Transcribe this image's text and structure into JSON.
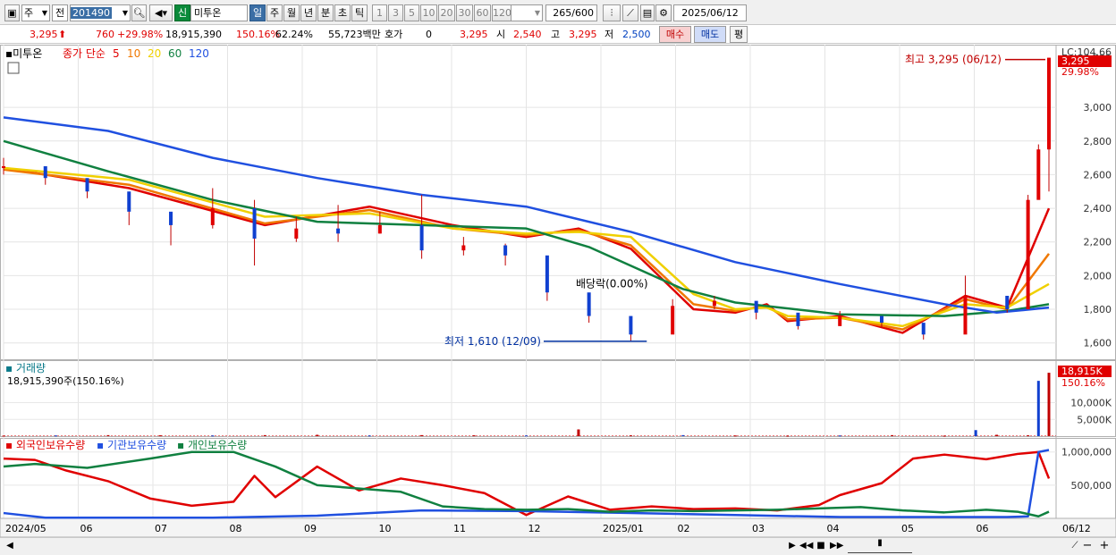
{
  "toolbar": {
    "period_type": "주",
    "market": "전",
    "code": "201490",
    "new_badge": "신",
    "stock_name": "미투온",
    "periods": [
      "일",
      "주",
      "월",
      "년",
      "분",
      "초",
      "틱"
    ],
    "active_period": "일",
    "intervals": [
      "1",
      "3",
      "5",
      "10",
      "20",
      "30",
      "60",
      "120"
    ],
    "count": "265",
    "count_total": "/600",
    "date": "2025/06/12"
  },
  "quote": {
    "price": "3,295",
    "change": "760",
    "change_pct": "+29.98%",
    "volume": "18,915,390",
    "volume_ratio": "150.16%",
    "turnover": "62.24%",
    "amount": "55,723백만",
    "hoga_label": "호가",
    "hoga_value": "0",
    "ask_price": "3,295",
    "open_label": "시",
    "open": "2,540",
    "high_label": "고",
    "high": "3,295",
    "low_label": "저",
    "low": "2,500",
    "buy_label": "매수",
    "sell_label": "매도",
    "avg_label": "평"
  },
  "price_panel": {
    "stock_label": "미투온",
    "ma_label": "종가 단순",
    "ma_periods": [
      {
        "label": "5",
        "color": "#e00000"
      },
      {
        "label": "10",
        "color": "#f07800"
      },
      {
        "label": "20",
        "color": "#f0d000"
      },
      {
        "label": "60",
        "color": "#108040"
      },
      {
        "label": "120",
        "color": "#2050e0"
      }
    ],
    "high_annot": "최고 3,295 (06/12)",
    "low_annot": "최저 1,610 (12/09)",
    "dividend_annot": "배당락(0.00%)",
    "top_tick_text": "LC:104.66",
    "price_tag": "3,295",
    "pct_tag": "29.98%"
  },
  "volume_panel": {
    "title": "거래량",
    "value_text": "18,915,390주(150.16%)",
    "tag": "18,915K",
    "pct_tag": "150.16%"
  },
  "holdings_panel": {
    "series": [
      {
        "label": "외국인보유수량",
        "color": "#e00000"
      },
      {
        "label": "기관보유수량",
        "color": "#2050e0"
      },
      {
        "label": "개인보유수량",
        "color": "#108040"
      }
    ]
  },
  "chart_data": [
    {
      "type": "line",
      "title": "",
      "y_ticks": [
        "3,295",
        "3,000",
        "2,800",
        "2,600",
        "2,400",
        "2,200",
        "2,000",
        "1,800",
        "1,600"
      ],
      "ylim": [
        1540,
        3330
      ],
      "x_ticks": [
        "2024/05",
        "06",
        "07",
        "08",
        "09",
        "10",
        "11",
        "12",
        "2025/01",
        "02",
        "03",
        "04",
        "05",
        "06",
        "06/12"
      ],
      "series": [
        {
          "name": "5",
          "color": "#e00000",
          "x": [
            0,
            12,
            25,
            35,
            43,
            50,
            55,
            60,
            66,
            70,
            73,
            75,
            80,
            86,
            92,
            96,
            100
          ],
          "values": [
            2640,
            2520,
            2300,
            2410,
            2300,
            2230,
            2280,
            2160,
            1800,
            1780,
            1830,
            1730,
            1760,
            1660,
            1880,
            1810,
            2400
          ]
        },
        {
          "name": "10",
          "color": "#f07800",
          "x": [
            0,
            12,
            25,
            35,
            43,
            50,
            55,
            60,
            66,
            70,
            73,
            75,
            80,
            86,
            92,
            96,
            100
          ],
          "values": [
            2630,
            2540,
            2310,
            2390,
            2280,
            2240,
            2270,
            2180,
            1830,
            1790,
            1820,
            1740,
            1750,
            1680,
            1860,
            1800,
            2130
          ]
        },
        {
          "name": "20",
          "color": "#f0d000",
          "x": [
            0,
            12,
            25,
            35,
            43,
            50,
            55,
            60,
            66,
            70,
            73,
            75,
            80,
            86,
            92,
            96,
            100
          ],
          "values": [
            2640,
            2570,
            2350,
            2370,
            2280,
            2250,
            2260,
            2230,
            1890,
            1800,
            1810,
            1760,
            1750,
            1700,
            1830,
            1810,
            1950
          ]
        },
        {
          "name": "60",
          "color": "#108040",
          "x": [
            0,
            10,
            20,
            30,
            40,
            50,
            56,
            65,
            70,
            80,
            90,
            96,
            100
          ],
          "values": [
            2800,
            2620,
            2450,
            2320,
            2300,
            2280,
            2170,
            1920,
            1840,
            1770,
            1760,
            1790,
            1830
          ]
        },
        {
          "name": "120",
          "color": "#2050e0",
          "x": [
            0,
            10,
            20,
            30,
            40,
            50,
            60,
            70,
            80,
            90,
            95,
            100
          ],
          "values": [
            2940,
            2860,
            2700,
            2580,
            2480,
            2410,
            2260,
            2080,
            1950,
            1830,
            1780,
            1810
          ]
        }
      ],
      "candles": {
        "x": [
          0,
          4,
          8,
          12,
          16,
          20,
          24,
          28,
          32,
          36,
          40,
          44,
          48,
          52,
          56,
          60,
          64,
          68,
          72,
          76,
          80,
          84,
          88,
          92,
          96,
          98,
          99,
          100
        ],
        "close": [
          2650,
          2580,
          2500,
          2380,
          2300,
          2400,
          2220,
          2280,
          2250,
          2300,
          2150,
          2180,
          2120,
          1900,
          1760,
          1650,
          1820,
          1850,
          1780,
          1700,
          1760,
          1720,
          1650,
          1880,
          1800,
          2450,
          2750,
          3295
        ],
        "high": [
          2700,
          2620,
          2560,
          2450,
          2350,
          2520,
          2450,
          2350,
          2420,
          2380,
          2480,
          2230,
          2190,
          1980,
          1830,
          1700,
          1860,
          1880,
          1820,
          1740,
          1790,
          1760,
          1700,
          2000,
          1850,
          2480,
          2780,
          3295
        ],
        "low": [
          2600,
          2540,
          2460,
          2300,
          2180,
          2280,
          2060,
          2200,
          2200,
          2250,
          2100,
          2120,
          2060,
          1850,
          1720,
          1610,
          1780,
          1800,
          1740,
          1680,
          1730,
          1690,
          1620,
          1700,
          1780,
          2200,
          2500,
          2500
        ]
      },
      "high_point": {
        "label": "3,295",
        "date": "06/12",
        "value": 3295
      },
      "low_point": {
        "label": "1,610",
        "date": "12/09",
        "value": 1610
      }
    },
    {
      "type": "bar",
      "title": "거래량",
      "y_ticks": [
        "18,915K",
        "10,000K",
        "5,000K"
      ],
      "ylim": [
        0,
        20000
      ],
      "x": [
        0,
        5,
        10,
        15,
        20,
        25,
        30,
        35,
        40,
        45,
        50,
        55,
        60,
        65,
        70,
        75,
        80,
        85,
        90,
        93,
        95,
        98,
        99,
        100
      ],
      "values": [
        150,
        200,
        300,
        250,
        200,
        300,
        400,
        200,
        300,
        250,
        200,
        2000,
        250,
        300,
        200,
        150,
        200,
        300,
        150,
        1800,
        400,
        250,
        16500,
        18915
      ]
    },
    {
      "type": "line",
      "title": "",
      "y_ticks": [
        "1,000,000",
        "500,000"
      ],
      "ylim": [
        0,
        1050000
      ],
      "series": [
        {
          "name": "외국인보유수량",
          "color": "#e00000",
          "x": [
            0,
            3,
            6,
            10,
            14,
            18,
            22,
            24,
            26,
            30,
            34,
            38,
            42,
            46,
            50,
            54,
            58,
            62,
            66,
            70,
            74,
            78,
            80,
            84,
            87,
            90,
            94,
            97,
            99,
            100
          ],
          "values": [
            900000,
            880000,
            720000,
            560000,
            300000,
            190000,
            250000,
            640000,
            320000,
            780000,
            420000,
            600000,
            500000,
            380000,
            50000,
            330000,
            130000,
            180000,
            140000,
            150000,
            120000,
            200000,
            350000,
            530000,
            900000,
            960000,
            890000,
            970000,
            1000000,
            600000
          ]
        },
        {
          "name": "기관보유수량",
          "color": "#2050e0",
          "x": [
            0,
            4,
            10,
            20,
            30,
            40,
            50,
            60,
            70,
            80,
            90,
            96,
            98,
            99,
            100
          ],
          "values": [
            80000,
            10000,
            10000,
            10000,
            40000,
            120000,
            110000,
            80000,
            50000,
            20000,
            20000,
            20000,
            30000,
            1000000,
            1030000
          ]
        },
        {
          "name": "개인보유수량",
          "color": "#108040",
          "x": [
            0,
            3,
            8,
            14,
            18,
            22,
            26,
            30,
            34,
            38,
            42,
            46,
            50,
            54,
            58,
            62,
            66,
            70,
            74,
            78,
            82,
            86,
            90,
            94,
            97,
            99,
            100
          ],
          "values": [
            780000,
            820000,
            760000,
            900000,
            1000000,
            1000000,
            780000,
            500000,
            450000,
            400000,
            180000,
            140000,
            130000,
            140000,
            100000,
            120000,
            110000,
            120000,
            130000,
            150000,
            170000,
            120000,
            90000,
            130000,
            100000,
            30000,
            100000
          ]
        }
      ]
    }
  ],
  "status": {
    "x_ticks": [
      "2024/05",
      "06",
      "07",
      "08",
      "09",
      "10",
      "11",
      "12",
      "2025/01",
      "02",
      "03",
      "04",
      "05",
      "06",
      "06/12"
    ]
  }
}
